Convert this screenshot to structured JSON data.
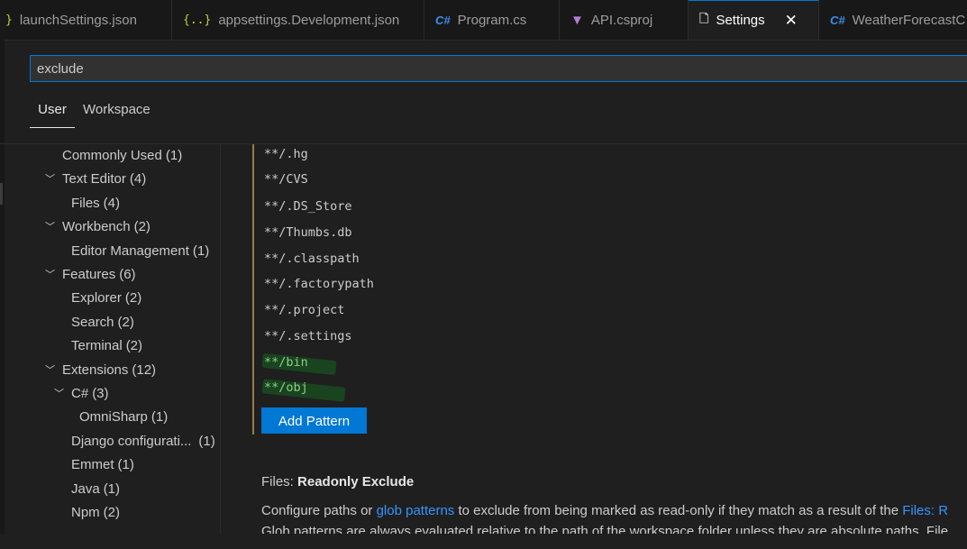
{
  "tabs": [
    {
      "icon": "json-icon",
      "glyph": "}",
      "label": "launchSettings.json"
    },
    {
      "icon": "json-icon",
      "glyph": "{..}",
      "label": "appsettings.Development.json"
    },
    {
      "icon": "csharp-icon",
      "glyph": "C#",
      "label": "Program.cs"
    },
    {
      "icon": "visualstudio-icon",
      "glyph": "▼",
      "label": "API.csproj"
    },
    {
      "icon": "file-icon",
      "glyph": "🗋",
      "label": "Settings",
      "active": true,
      "close": "✕"
    },
    {
      "icon": "csharp-icon",
      "glyph": "C#",
      "label": "WeatherForecastC"
    }
  ],
  "search": {
    "value": "exclude"
  },
  "scope_tabs": {
    "user": "User",
    "workspace": "Workspace"
  },
  "toc": {
    "commonly_used": {
      "label": "Commonly Used",
      "count": "(1)"
    },
    "text_editor": {
      "label": "Text Editor",
      "count": "(4)"
    },
    "files": {
      "label": "Files",
      "count": "(4)"
    },
    "workbench": {
      "label": "Workbench",
      "count": "(2)"
    },
    "editor_management": {
      "label": "Editor Management",
      "count": "(1)"
    },
    "features": {
      "label": "Features",
      "count": "(6)"
    },
    "explorer": {
      "label": "Explorer",
      "count": "(2)"
    },
    "search": {
      "label": "Search",
      "count": "(2)"
    },
    "terminal": {
      "label": "Terminal",
      "count": "(2)"
    },
    "extensions": {
      "label": "Extensions",
      "count": "(12)"
    },
    "csharp": {
      "label": "C#",
      "count": "(3)"
    },
    "omnisharp": {
      "label": "OmniSharp",
      "count": "(1)"
    },
    "django": {
      "label": "Django configurati...",
      "count": "(1)"
    },
    "emmet": {
      "label": "Emmet",
      "count": "(1)"
    },
    "java": {
      "label": "Java",
      "count": "(1)"
    },
    "npm": {
      "label": "Npm",
      "count": "(2)"
    }
  },
  "patterns": [
    "**/.hg",
    "**/CVS",
    "**/.DS_Store",
    "**/Thumbs.db",
    "**/.classpath",
    "**/.factorypath",
    "**/.project",
    "**/.settings",
    "**/bin",
    "**/obj"
  ],
  "add_pattern_label": "Add Pattern",
  "readonly": {
    "category": "Files: ",
    "name": "Readonly Exclude",
    "desc_before": "Configure paths or ",
    "desc_link": "glob patterns",
    "desc_middle": " to exclude from being marked as read-only if they match as a result of the ",
    "desc_link2": "Files: R",
    "desc_line2": "Glob patterns are always evaluated relative to the path of the workspace folder unless they are absolute paths. File"
  },
  "colors": {
    "accent": "#0078d4",
    "modified": "#89d185",
    "link": "#3794ff"
  }
}
